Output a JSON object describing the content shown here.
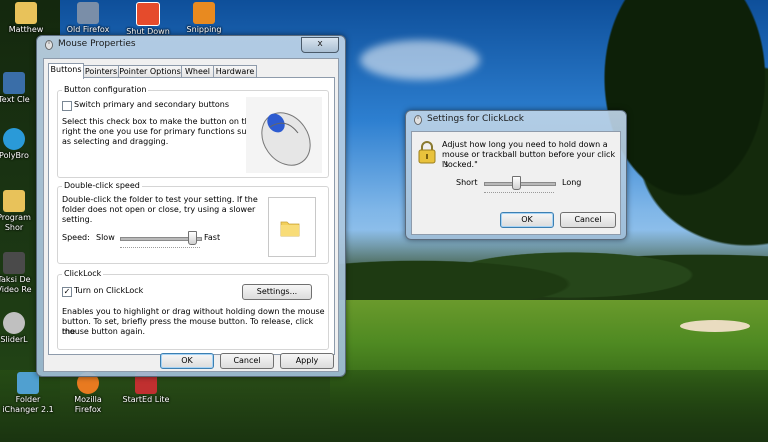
{
  "desktop": {
    "icons": [
      {
        "label": "Matthew",
        "color": "#e8c25a"
      },
      {
        "label": "Old Firefox",
        "color": "#7a8ea8"
      },
      {
        "label": "Shut Down",
        "color": "#e54b2c"
      },
      {
        "label": "Snipping",
        "color": "#e88a20"
      },
      {
        "label": "Text Cle",
        "color": "#3a6ea8"
      },
      {
        "label": "PolyBro",
        "color": "#2a9ad8"
      },
      {
        "label": "Program",
        "color": "#e8c25a"
      },
      {
        "label": "Shor",
        "color": "#e8c25a"
      },
      {
        "label": "Taksi De",
        "color": "#4a4a4a"
      },
      {
        "label": "Video Re",
        "color": "#4a4a4a"
      },
      {
        "label": "SliderL",
        "color": "#c0c0c0"
      },
      {
        "label": "Folder",
        "color": "#50a0d0"
      },
      {
        "label": "iChanger 2.1",
        "color": "#50a0d0"
      },
      {
        "label": "Mozilla",
        "color": "#e87a20"
      },
      {
        "label": "Firefox",
        "color": "#e87a20"
      },
      {
        "label": "StartEd Lite",
        "color": "#c03030"
      }
    ]
  },
  "mouse_properties": {
    "title": "Mouse Properties",
    "close_label": "x",
    "tabs": [
      {
        "label": "Buttons"
      },
      {
        "label": "Pointers"
      },
      {
        "label": "Pointer Options"
      },
      {
        "label": "Wheel"
      },
      {
        "label": "Hardware"
      }
    ],
    "button_config": {
      "group_title": "Button configuration",
      "switch_label": "Switch primary and secondary buttons",
      "switch_checked": false,
      "description_lines": [
        "Select this check box to make the button on the",
        "right the one you use for primary functions such",
        "as selecting and dragging."
      ]
    },
    "double_click": {
      "group_title": "Double-click speed",
      "description_lines": [
        "Double-click the folder to test your setting. If the",
        "folder does not open or close, try using a slower",
        "setting."
      ],
      "speed_label": "Speed:",
      "slow_label": "Slow",
      "fast_label": "Fast",
      "speed_value": 0.9
    },
    "clicklock": {
      "group_title": "ClickLock",
      "enable_label": "Turn on ClickLock",
      "enable_checked": true,
      "settings_button": "Settings...",
      "description_lines": [
        "Enables you to highlight or drag without holding down the mouse",
        "button. To set, briefly press the mouse button. To release, click the",
        "mouse button again."
      ]
    },
    "buttons": {
      "ok": "OK",
      "cancel": "Cancel",
      "apply": "Apply"
    }
  },
  "clicklock_settings": {
    "title": "Settings for ClickLock",
    "description_lines": [
      "Adjust how long you need to hold down a",
      "mouse or trackball button before your click is",
      "\"locked.\""
    ],
    "short_label": "Short",
    "long_label": "Long",
    "hold_value": 0.45,
    "buttons": {
      "ok": "OK",
      "cancel": "Cancel"
    }
  }
}
